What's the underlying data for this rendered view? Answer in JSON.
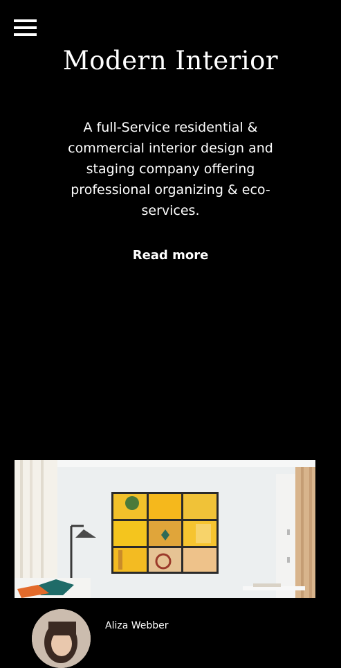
{
  "header": {
    "menu_icon": "hamburger-menu-icon",
    "title": "Modern Interior"
  },
  "hero": {
    "description": "A full-Service residential & commercial interior design and staging company offering professional organizing & eco-services.",
    "read_more_label": "Read more"
  },
  "post": {
    "image": "living-room-wall-art-image",
    "author_avatar": "author-avatar-image",
    "author_name": "Aliza Webber"
  }
}
